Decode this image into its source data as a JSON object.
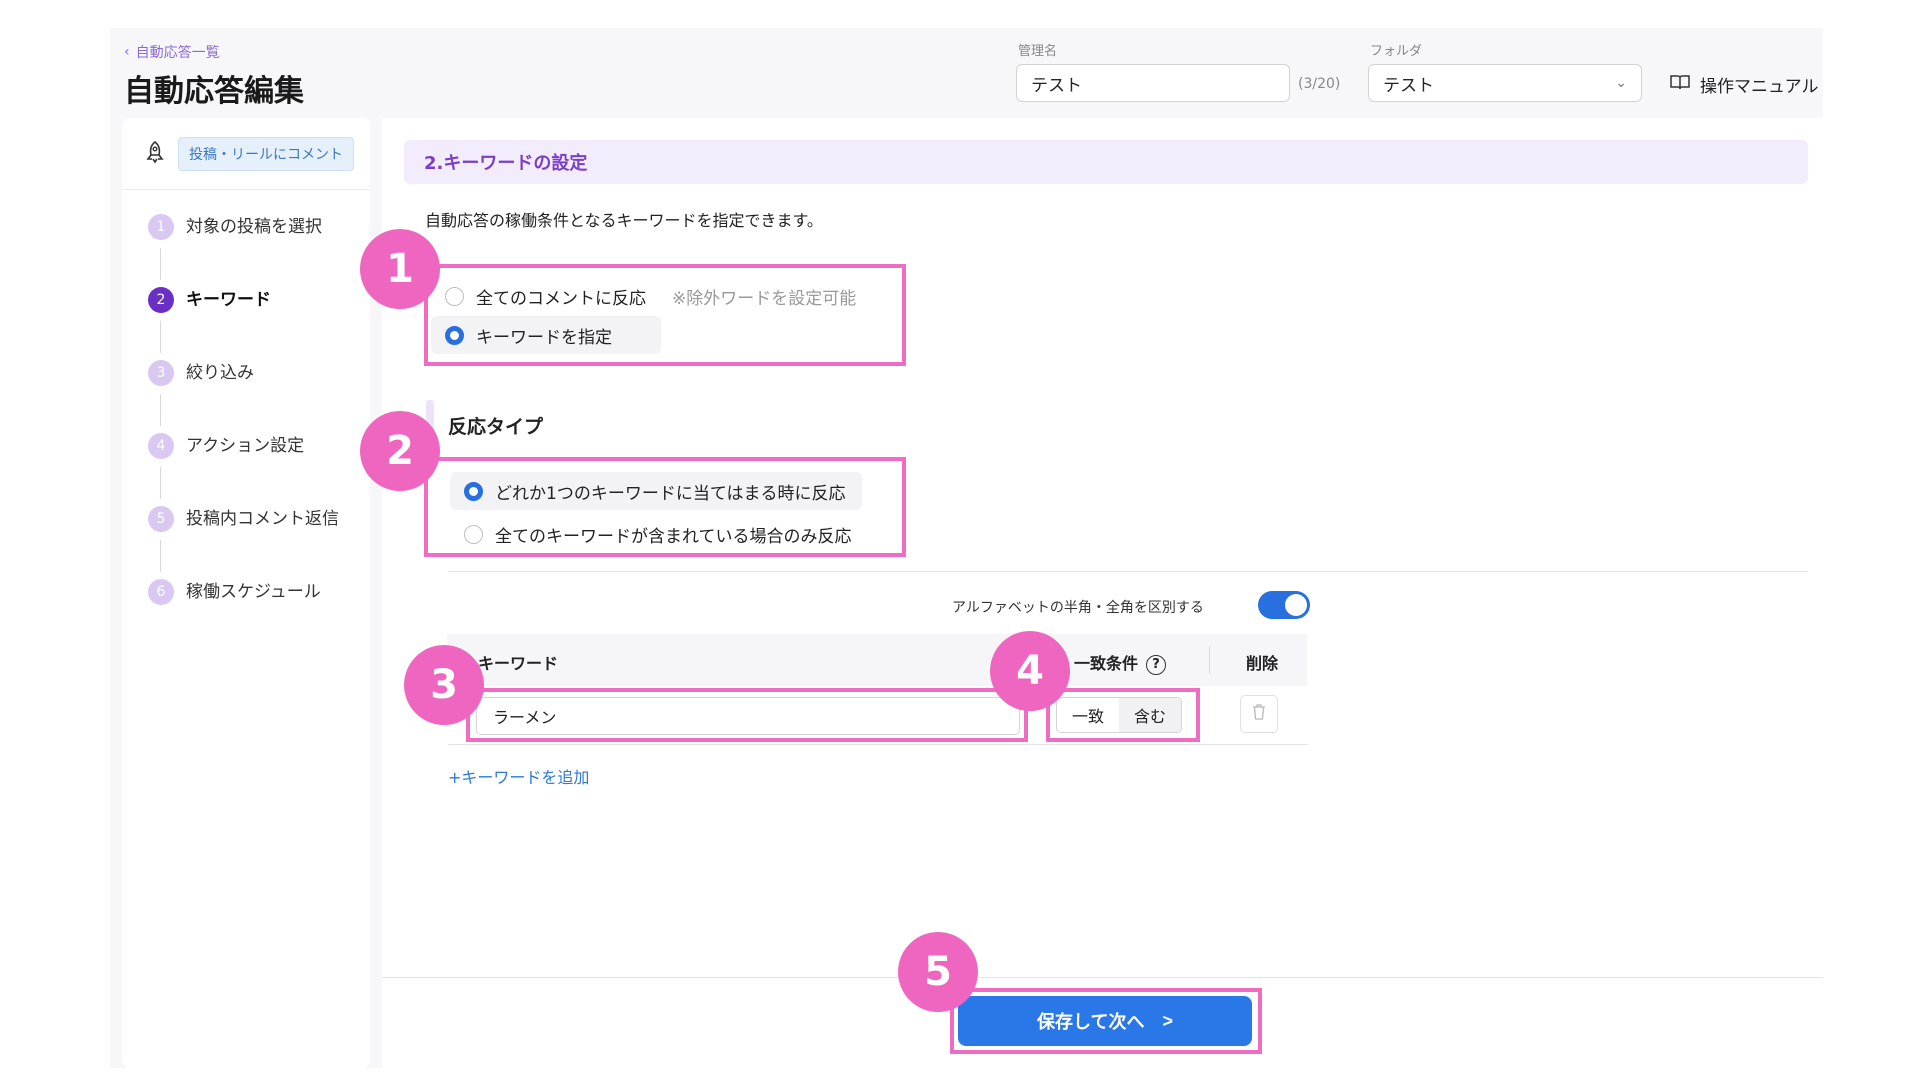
{
  "header": {
    "back_label": "自動応答一覧",
    "title": "自動応答編集",
    "name_label": "管理名",
    "name_value": "テスト",
    "name_counter": "(3/20)",
    "folder_label": "フォルダ",
    "folder_value": "テスト",
    "manual_label": "操作マニュアル"
  },
  "sidebar": {
    "type_badge": "投稿・リールにコメント",
    "steps": [
      {
        "num": "1",
        "label": "対象の投稿を選択"
      },
      {
        "num": "2",
        "label": "キーワード"
      },
      {
        "num": "3",
        "label": "絞り込み"
      },
      {
        "num": "4",
        "label": "アクション設定"
      },
      {
        "num": "5",
        "label": "投稿内コメント返信"
      },
      {
        "num": "6",
        "label": "稼働スケジュール"
      }
    ],
    "active_step": 2
  },
  "main": {
    "section_title": "2.キーワードの設定",
    "description": "自動応答の稼働条件となるキーワードを指定できます。",
    "mode_options": [
      {
        "label": "全てのコメントに反応",
        "hint": "※除外ワードを設定可能",
        "selected": false
      },
      {
        "label": "キーワードを指定",
        "hint": "",
        "selected": true
      }
    ],
    "reaction_heading": "反応タイプ",
    "reaction_options": [
      {
        "label": "どれか1つのキーワードに当てはまる時に反応",
        "selected": true
      },
      {
        "label": "全てのキーワードが含まれている場合のみ反応",
        "selected": false
      }
    ],
    "toggle_label": "アルファベットの半角・全角を区別する",
    "toggle_on": true,
    "table": {
      "col_keyword": "キーワード",
      "col_match": "一致条件",
      "col_delete": "削除",
      "help_icon": "?",
      "rows": [
        {
          "keyword": "ラーメン",
          "match_exact": "一致",
          "match_contains": "含む",
          "selected_match": "一致"
        }
      ]
    },
    "add_keyword": "+キーワードを追加",
    "save_button": "保存して次へ"
  },
  "annotations": [
    "1",
    "2",
    "3",
    "4",
    "5"
  ],
  "colors": {
    "accent": "#2a77e8",
    "purple": "#7a3ec9",
    "highlight": "#ee6cc2"
  }
}
